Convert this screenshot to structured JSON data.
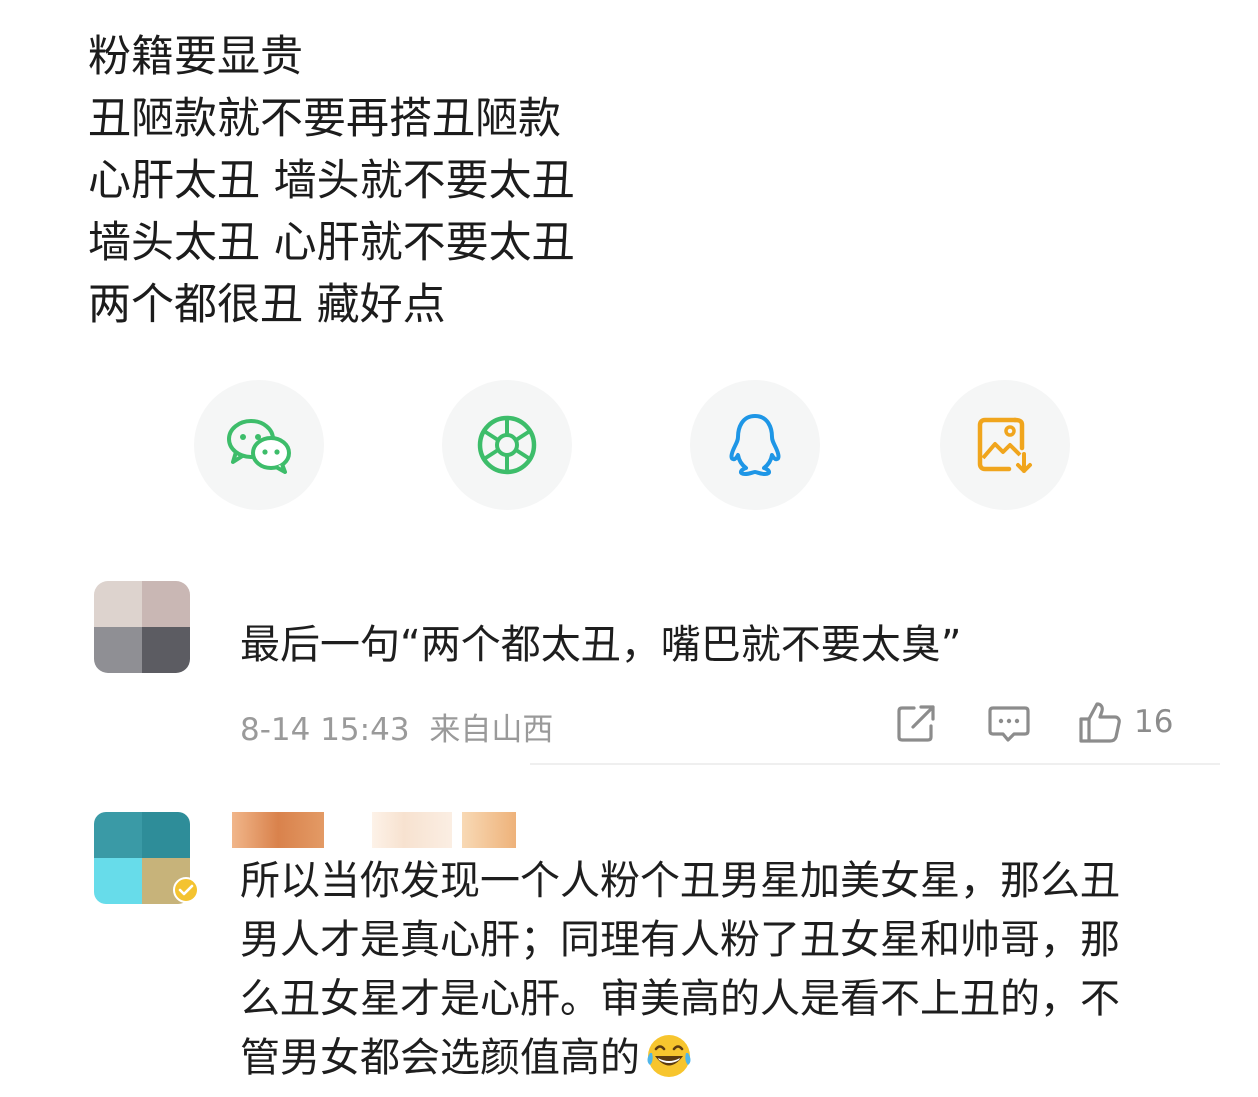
{
  "post": {
    "lines": [
      "粉籍要显贵",
      "丑陋款就不要再搭丑陋款",
      "心肝太丑 墙头就不要太丑",
      "墙头太丑 心肝就不要太丑",
      "两个都很丑 藏好点"
    ]
  },
  "share": {
    "items": [
      {
        "icon": "wechat-icon",
        "color": "#3dbd6a"
      },
      {
        "icon": "moments-icon",
        "color": "#3dbd6a"
      },
      {
        "icon": "qq-icon",
        "color": "#1e96e6"
      },
      {
        "icon": "save-image-icon",
        "color": "#f0a51d"
      }
    ]
  },
  "comments": [
    {
      "text": "最后一句“两个都太丑，嘴巴就不要太臭”",
      "timestamp": "8-14 15:43",
      "location": "来自山西",
      "likes": "16"
    },
    {
      "lines": [
        "所以当你发现一个人粉个丑男星加美女星，那么丑",
        "男人才是真心肝；同理有人粉了丑女星和帅哥，那",
        "么丑女星才是心肝。审美高的人是看不上丑的，不",
        "管男女都会选颜值高的"
      ],
      "emoji": "laughing-tears-emoji"
    }
  ],
  "colors": {
    "text": "#1c1c1c",
    "meta": "#9a9a9a",
    "share_bg": "#f5f6f6"
  }
}
